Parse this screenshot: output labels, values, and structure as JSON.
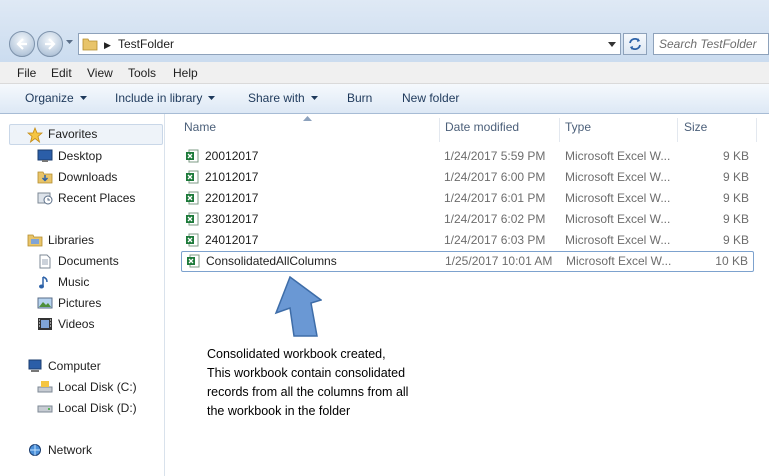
{
  "address": {
    "path": "TestFolder"
  },
  "search": {
    "placeholder": "Search TestFolder"
  },
  "menu": [
    "File",
    "Edit",
    "View",
    "Tools",
    "Help"
  ],
  "toolbar": {
    "organize": "Organize",
    "include": "Include in library",
    "share": "Share with",
    "burn": "Burn",
    "new_folder": "New folder"
  },
  "nav": {
    "favorites": "Favorites",
    "desktop": "Desktop",
    "downloads": "Downloads",
    "recent": "Recent Places",
    "libraries": "Libraries",
    "documents": "Documents",
    "music": "Music",
    "pictures": "Pictures",
    "videos": "Videos",
    "computer": "Computer",
    "disk_c": "Local Disk (C:)",
    "disk_d": "Local Disk (D:)",
    "network": "Network"
  },
  "columns": {
    "name": "Name",
    "date": "Date modified",
    "type": "Type",
    "size": "Size"
  },
  "files": [
    {
      "name": "20012017",
      "date": "1/24/2017 5:59 PM",
      "type": "Microsoft Excel W...",
      "size": "9 KB"
    },
    {
      "name": "21012017",
      "date": "1/24/2017 6:00 PM",
      "type": "Microsoft Excel W...",
      "size": "9 KB"
    },
    {
      "name": "22012017",
      "date": "1/24/2017 6:01 PM",
      "type": "Microsoft Excel W...",
      "size": "9 KB"
    },
    {
      "name": "23012017",
      "date": "1/24/2017 6:02 PM",
      "type": "Microsoft Excel W...",
      "size": "9 KB"
    },
    {
      "name": "24012017",
      "date": "1/24/2017 6:03 PM",
      "type": "Microsoft Excel W...",
      "size": "9 KB"
    },
    {
      "name": "ConsolidatedAllColumns",
      "date": "1/25/2017 10:01 AM",
      "type": "Microsoft Excel W...",
      "size": "10 KB"
    }
  ],
  "annotation": {
    "lines": [
      "Consolidated workbook created,",
      "This workbook contain consolidated",
      "records from all the columns from all",
      "the workbook in the folder"
    ]
  },
  "colors": {
    "arrow_fill": "#6a98d4",
    "arrow_stroke": "#3e6da8",
    "excel_green": "#1d7a3a",
    "selection_border": "#7da2ce"
  }
}
